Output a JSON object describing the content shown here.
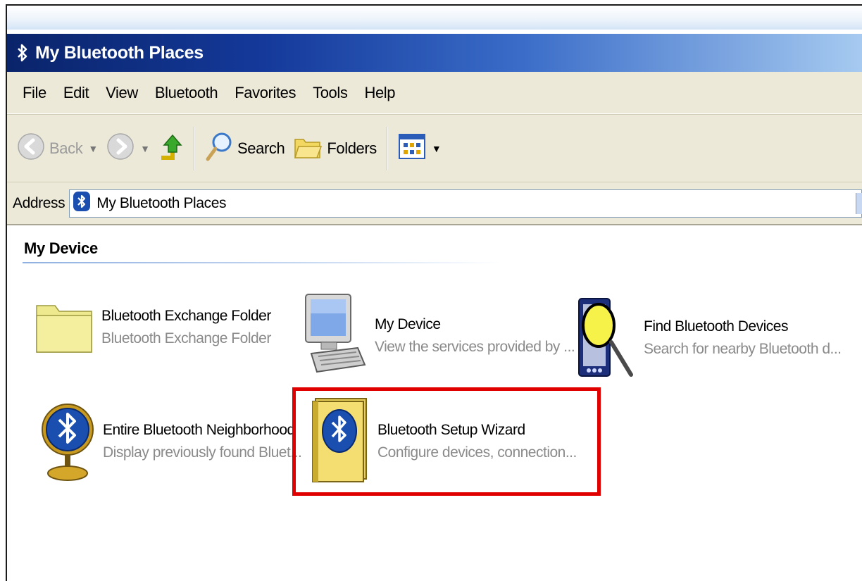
{
  "window": {
    "title": "My Bluetooth Places"
  },
  "menu": [
    "File",
    "Edit",
    "View",
    "Bluetooth",
    "Favorites",
    "Tools",
    "Help"
  ],
  "toolbar": {
    "back_label": "Back",
    "search_label": "Search",
    "folders_label": "Folders"
  },
  "address": {
    "label": "Address",
    "value": "My Bluetooth Places"
  },
  "section": {
    "title": "My Device"
  },
  "items": [
    {
      "name": "Bluetooth Exchange Folder",
      "description": "Bluetooth Exchange Folder",
      "icon": "folder-icon"
    },
    {
      "name": "My Device",
      "description": "View the services provided by ...",
      "icon": "computer-icon"
    },
    {
      "name": "Find Bluetooth Devices",
      "description": "Search for nearby Bluetooth d...",
      "icon": "magnifier-device-icon"
    },
    {
      "name": "Entire Bluetooth Neighborhood",
      "description": "Display previously found Bluet...",
      "icon": "bluetooth-globe-icon"
    },
    {
      "name": "Bluetooth Setup Wizard",
      "description": "Configure devices, connection...",
      "icon": "bluetooth-wizard-icon"
    }
  ],
  "highlight": {
    "color": "#e00000"
  },
  "colors": {
    "titlebar_start": "#0a246a",
    "titlebar_end": "#a6caf0",
    "chrome": "#ece9d8",
    "bluetooth": "#1a4fb0"
  }
}
